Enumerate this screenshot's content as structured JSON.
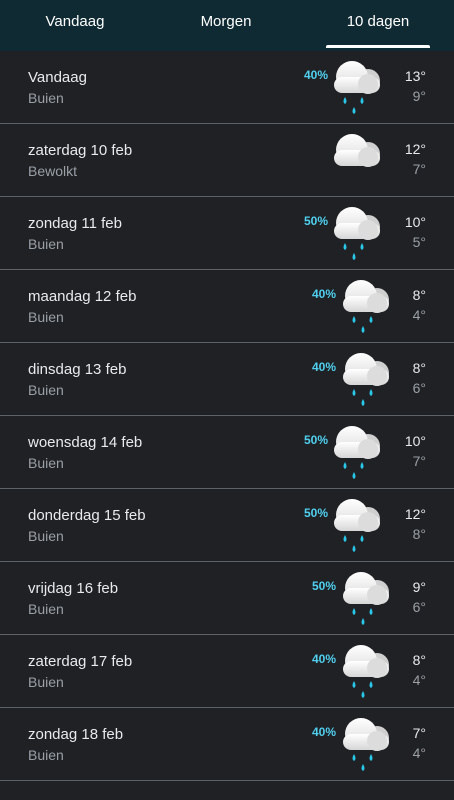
{
  "tabs": [
    {
      "label": "Vandaag",
      "active": false
    },
    {
      "label": "Morgen",
      "active": false
    },
    {
      "label": "10 dagen",
      "active": true
    }
  ],
  "colors": {
    "tab_bar": "#0f2a33",
    "background": "#202124",
    "precip": "#4fd0f0",
    "divider": "#5f6368"
  },
  "forecast": [
    {
      "day": "Vandaag",
      "condition": "Buien",
      "precip": "40%",
      "icon": "rain-cloud-icon",
      "high": "13°",
      "low": "9°"
    },
    {
      "day": "zaterdag 10 feb",
      "condition": "Bewolkt",
      "precip": "",
      "icon": "cloud-icon",
      "high": "12°",
      "low": "7°"
    },
    {
      "day": "zondag 11 feb",
      "condition": "Buien",
      "precip": "50%",
      "icon": "rain-cloud-icon",
      "high": "10°",
      "low": "5°"
    },
    {
      "day": "maandag 12 feb",
      "condition": "Buien",
      "precip": "40%",
      "icon": "rain-cloud-icon",
      "high": "8°",
      "low": "4°"
    },
    {
      "day": "dinsdag 13 feb",
      "condition": "Buien",
      "precip": "40%",
      "icon": "rain-cloud-icon",
      "high": "8°",
      "low": "6°"
    },
    {
      "day": "woensdag 14 feb",
      "condition": "Buien",
      "precip": "50%",
      "icon": "rain-cloud-icon",
      "high": "10°",
      "low": "7°"
    },
    {
      "day": "donderdag 15 feb",
      "condition": "Buien",
      "precip": "50%",
      "icon": "rain-cloud-icon",
      "high": "12°",
      "low": "8°"
    },
    {
      "day": "vrijdag 16 feb",
      "condition": "Buien",
      "precip": "50%",
      "icon": "rain-cloud-icon",
      "high": "9°",
      "low": "6°"
    },
    {
      "day": "zaterdag 17 feb",
      "condition": "Buien",
      "precip": "40%",
      "icon": "rain-cloud-icon",
      "high": "8°",
      "low": "4°"
    },
    {
      "day": "zondag 18 feb",
      "condition": "Buien",
      "precip": "40%",
      "icon": "rain-cloud-icon",
      "high": "7°",
      "low": "4°"
    }
  ]
}
